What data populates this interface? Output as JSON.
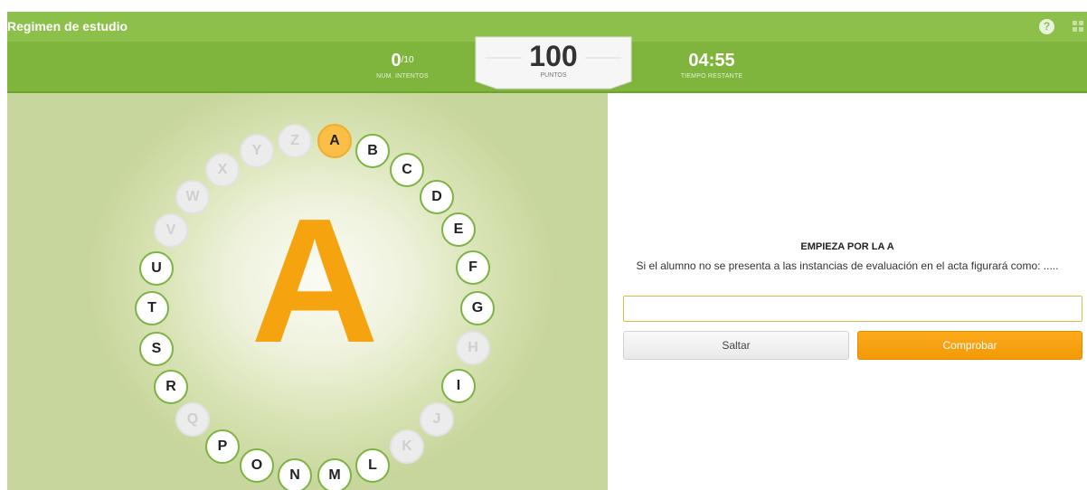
{
  "header": {
    "title": "Regimen de estudio",
    "help_icon": "?",
    "icons": [
      "help-icon",
      "grid-icon"
    ],
    "colors": {
      "bar": "#8cc04b",
      "score_bar": "#7fb43d",
      "accent": "#f5a410"
    }
  },
  "score": {
    "attempts_value": "0",
    "attempts_max": "/10",
    "attempts_label": "NUM. INTENTOS",
    "points_value": "100",
    "points_label": "PUNTOS",
    "time_value": "04:55",
    "time_label": "TIEMPO RESTANTE"
  },
  "game": {
    "current_letter": "A",
    "letters": [
      {
        "letter": "A",
        "state": "current"
      },
      {
        "letter": "B",
        "state": "active"
      },
      {
        "letter": "C",
        "state": "active"
      },
      {
        "letter": "D",
        "state": "active"
      },
      {
        "letter": "E",
        "state": "active"
      },
      {
        "letter": "F",
        "state": "active"
      },
      {
        "letter": "G",
        "state": "active"
      },
      {
        "letter": "H",
        "state": "inactive"
      },
      {
        "letter": "I",
        "state": "active"
      },
      {
        "letter": "J",
        "state": "inactive"
      },
      {
        "letter": "K",
        "state": "inactive"
      },
      {
        "letter": "L",
        "state": "active"
      },
      {
        "letter": "M",
        "state": "active"
      },
      {
        "letter": "N",
        "state": "active"
      },
      {
        "letter": "O",
        "state": "active"
      },
      {
        "letter": "P",
        "state": "active"
      },
      {
        "letter": "Q",
        "state": "inactive"
      },
      {
        "letter": "R",
        "state": "active"
      },
      {
        "letter": "S",
        "state": "active"
      },
      {
        "letter": "T",
        "state": "active"
      },
      {
        "letter": "U",
        "state": "active"
      },
      {
        "letter": "V",
        "state": "inactive"
      },
      {
        "letter": "W",
        "state": "inactive"
      },
      {
        "letter": "X",
        "state": "inactive"
      },
      {
        "letter": "Y",
        "state": "inactive"
      },
      {
        "letter": "Z",
        "state": "inactive"
      }
    ]
  },
  "question": {
    "title": "EMPIEZA POR LA A",
    "text": "Si el alumno no se presenta a las instancias de evaluación en el acta figurará como: .....",
    "answer_value": "",
    "answer_placeholder": "",
    "skip_label": "Saltar",
    "check_label": "Comprobar"
  }
}
